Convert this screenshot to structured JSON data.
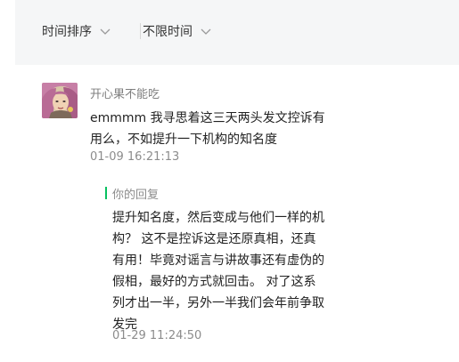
{
  "filters": {
    "sort_label": "时间排序",
    "time_label": "不限时间"
  },
  "comment": {
    "username": "开心果不能吃",
    "text": "emmmm 我寻思着这三天两头发文控诉有用么，不如提升一下机构的知名度",
    "time": "01-09 16:21:13"
  },
  "reply": {
    "label": "你的回复",
    "text": "提升知名度，然后变成与他们一样的机构？ 这不是控诉这是还原真相，还真有用！毕竟对谣言与讲故事还有虚伪的假相，最好的方式就回击。 对了这系列才出一半，另外一半我们会年前争取发完",
    "time": "01-29 11:24:50"
  },
  "colors": {
    "accent_green": "#07c160",
    "filter_bg": "#f5f6f7",
    "meta_gray": "#8c8c8c"
  },
  "icons": {
    "dropdown": "chevron-down-icon",
    "avatar": "avatar"
  }
}
